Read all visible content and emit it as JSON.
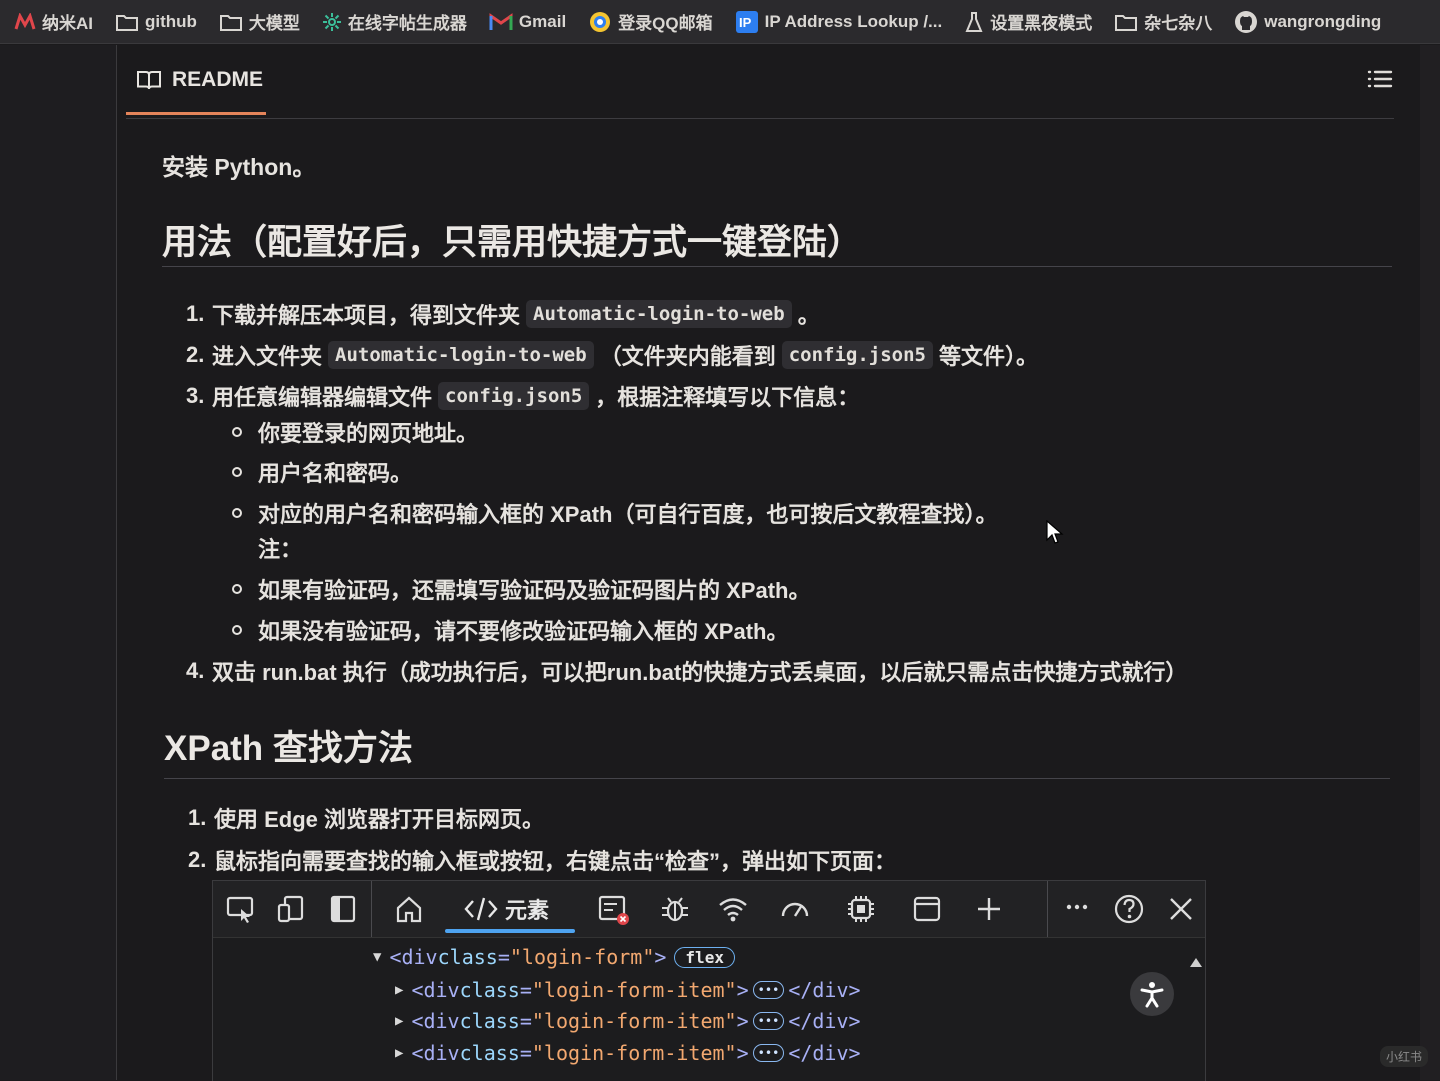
{
  "bookmarks": [
    {
      "label": "纳米AI",
      "icon": "nami-ai-icon"
    },
    {
      "label": "github",
      "icon": "folder-icon"
    },
    {
      "label": "大模型",
      "icon": "folder-icon"
    },
    {
      "label": "在线字帖生成器",
      "icon": "gear-flower-icon"
    },
    {
      "label": "Gmail",
      "icon": "gmail-icon"
    },
    {
      "label": "登录QQ邮箱",
      "icon": "qq-icon"
    },
    {
      "label": "IP Address Lookup /...",
      "icon": "ip-icon"
    },
    {
      "label": "设置黑夜模式",
      "icon": "flask-icon"
    },
    {
      "label": "杂七杂八",
      "icon": "folder-icon"
    },
    {
      "label": "wangrongding",
      "icon": "github-icon"
    }
  ],
  "readme": {
    "tab_label": "README",
    "intro": "安装 Python。",
    "usage_heading": "用法（配置好后，只需用快捷方式一键登陆）",
    "steps": [
      {
        "num": "1.",
        "pre": "下载并解压本项目，得到文件夹",
        "code1": "Automatic-login-to-web",
        "post": "。"
      },
      {
        "num": "2.",
        "pre": "进入文件夹",
        "code1": "Automatic-login-to-web",
        "mid": "（文件夹内能看到",
        "code2": "config.json5",
        "post": "等文件）。"
      },
      {
        "num": "3.",
        "pre": "用任意编辑器编辑文件",
        "code1": "config.json5",
        "post": "，根据注释填写以下信息："
      }
    ],
    "sub_items": [
      "你要登录的网页地址。",
      "用户名和密码。",
      "对应的用户名和密码输入框的 XPath（可自行百度，也可按后文教程查找）。",
      "如果有验证码，还需填写验证码及验证码图片的 XPath。",
      "如果没有验证码，请不要修改验证码输入框的 XPath。"
    ],
    "note": "注：",
    "step4": {
      "num": "4.",
      "text": "双击 run.bat 执行（成功执行后，可以把run.bat的快捷方式丢桌面，以后就只需点击快捷方式就行）"
    },
    "xpath_heading": "XPath 查找方法",
    "xpath_steps": [
      {
        "num": "1.",
        "text": "使用 Edge 浏览器打开目标网页。"
      },
      {
        "num": "2.",
        "text": "鼠标指向需要查找的输入框或按钮，右键点击“检查”，弹出如下页面："
      }
    ]
  },
  "devtools": {
    "tab_label": "元素",
    "root_tag_open": "<div ",
    "attr_name": "class",
    "root_class": "\"login-form\"",
    "close_bracket": ">",
    "badge": "flex",
    "child_class": "\"login-form-item\"",
    "ellipsis": "•••",
    "close_tag": "</div>"
  },
  "watermark": "小红书"
}
